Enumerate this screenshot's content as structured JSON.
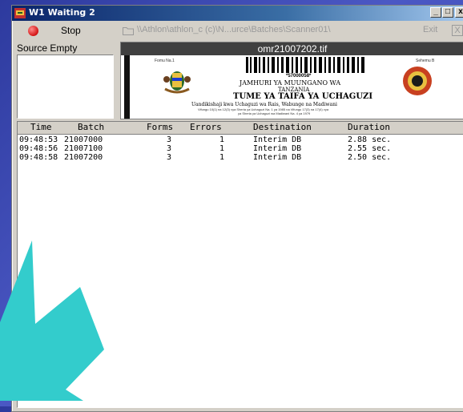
{
  "window": {
    "title": "W1 Waiting 2"
  },
  "toolbar": {
    "stop_label": "Stop",
    "path": "\\\\Athlon\\athlon_c (c)\\N...urce\\Batches\\Scanner01\\",
    "exit_label": "Exit",
    "close_glyph": "X"
  },
  "source": {
    "label": "Source Empty"
  },
  "image_panel": {
    "filename": "omr21007202.tif",
    "form_no_label": "Fomu Na.1",
    "sehemu_label": "Sehemu B",
    "barcode_number": "*57000058*",
    "line1": "JAMHURI YA MUUNGANO WA",
    "line2": "TANZANIA",
    "line3": "TUME YA TAIFA YA UCHAGUZI",
    "line4": "Uandikishaji kwa Uchaguzi wa Rais, Wabunge na Madiwani",
    "line5": "Vifungu 10(1) na 12(3) vya Sheria ya Uchaguzi Na. 1 ya 1985 na Vifungu 17(3) na 17(4) vya",
    "line6": "ya Sheria ya Uchaguzi wa Madiwani Na. 4 ya 1979"
  },
  "log": {
    "headers": {
      "time": "Time",
      "batch": "Batch",
      "forms": "Forms",
      "errors": "Errors",
      "destination": "Destination",
      "duration": "Duration"
    },
    "rows": [
      {
        "time": "09:48:53",
        "batch": "21007000",
        "forms": "3",
        "errors": "1",
        "destination": "Interim DB",
        "duration": "2.88 sec."
      },
      {
        "time": "09:48:56",
        "batch": "21007100",
        "forms": "3",
        "errors": "1",
        "destination": "Interim DB",
        "duration": "2.55 sec."
      },
      {
        "time": "09:48:58",
        "batch": "21007200",
        "forms": "3",
        "errors": "1",
        "destination": "Interim DB",
        "duration": "2.50 sec."
      }
    ]
  },
  "icons": {
    "app": "app-icon",
    "stop": "stop-icon",
    "folder": "folder-icon",
    "minimize": "minimize-icon",
    "maximize": "maximize-icon",
    "close": "close-icon",
    "arrow": "arrow-icon"
  },
  "colors": {
    "desktop": "#3a47b4",
    "arrow": "#33cccc",
    "titlebar": "#0a246a",
    "stop": "#d31414"
  }
}
